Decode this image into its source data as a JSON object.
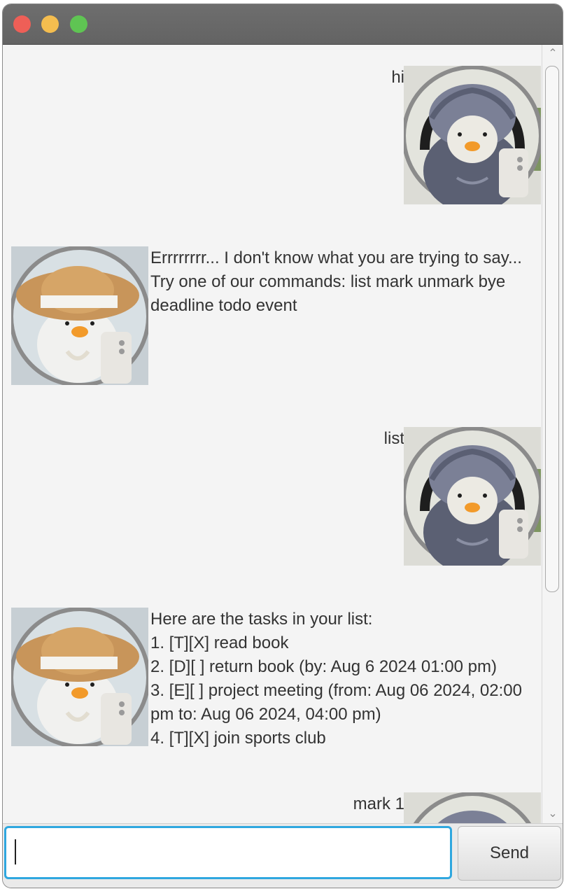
{
  "window": {
    "buttons": {
      "close": "close",
      "minimize": "minimize",
      "maximize": "maximize"
    }
  },
  "dialogs": [
    {
      "sender": "user",
      "text": "hi",
      "avatar": "user-avatar-hooded-duck"
    },
    {
      "sender": "bot",
      "text": "Errrrrrrr... I don't know what you are trying to say...\nTry one of our commands: list mark unmark bye deadline todo event",
      "avatar": "bot-avatar-straw-hat-duck"
    },
    {
      "sender": "user",
      "text": "list",
      "avatar": "user-avatar-hooded-duck"
    },
    {
      "sender": "bot",
      "text": "Here are the tasks in your list:\n1. [T][X] read book\n2. [D][ ] return book (by: Aug 6 2024 01:00 pm)\n3. [E][ ] project meeting (from: Aug 06 2024, 02:00 pm to: Aug 06 2024, 04:00 pm)\n4. [T][X] join sports club",
      "avatar": "bot-avatar-straw-hat-duck"
    },
    {
      "sender": "user",
      "text": "mark 1",
      "avatar": "user-avatar-hooded-duck"
    }
  ],
  "input": {
    "value": "",
    "placeholder": ""
  },
  "send_label": "Send",
  "colors": {
    "titlebar": "#666666",
    "background": "#f4f4f4",
    "input_focus": "#2fa7df"
  }
}
